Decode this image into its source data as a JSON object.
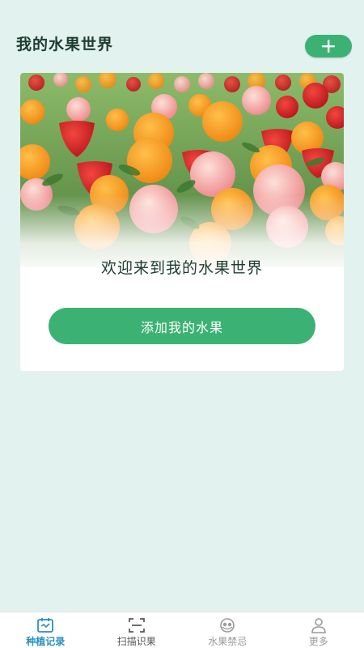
{
  "header": {
    "title": "我的水果世界",
    "add_icon": "plus-icon"
  },
  "card": {
    "image": "fruit-field-image",
    "welcome_text": "欢迎来到我的水果世界",
    "button_label": "添加我的水果"
  },
  "tabbar": {
    "items": [
      {
        "label": "种植记录",
        "icon": "calendar-icon",
        "active": true
      },
      {
        "label": "扫描识果",
        "icon": "scan-icon",
        "active": false
      },
      {
        "label": "水果禁忌",
        "icon": "fruit-bowl-icon",
        "active": false
      },
      {
        "label": "更多",
        "icon": "user-icon",
        "active": false
      }
    ]
  },
  "colors": {
    "background": "#e2f2ef",
    "accent": "#3bb273",
    "active_tab": "#2a8fbf"
  }
}
